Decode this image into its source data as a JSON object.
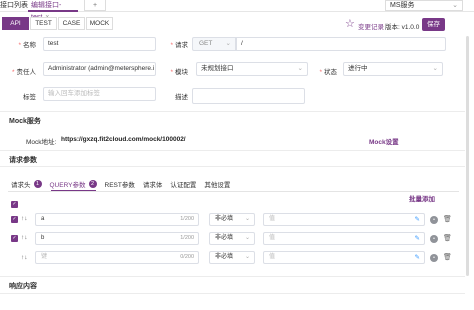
{
  "top_tabs": {
    "list": "接口列表",
    "edit": "编辑接口-test",
    "close": "×",
    "add": "+"
  },
  "workspace": {
    "value": "MS服务",
    "chevron": "⌄"
  },
  "protocol_tabs": [
    "API",
    "TEST",
    "CASE",
    "MOCK"
  ],
  "header": {
    "changelog": "变更记录",
    "version": "版本: v1.0.0",
    "save": "保存"
  },
  "form": {
    "name_label": "名称",
    "name_value": "test",
    "request_label": "请求",
    "method": "GET",
    "path": "/",
    "owner_label": "责任人",
    "owner_value": "Administrator (admin@metersphere.i",
    "module_label": "模块",
    "module_value": "未规划接口",
    "status_label": "状态",
    "status_value": "进行中",
    "tag_label": "标签",
    "tag_placeholder": "输入回车添加标签",
    "desc_label": "描述"
  },
  "mock": {
    "title": "Mock服务",
    "addr_label": "Mock地址:",
    "addr": "https://gxzq.fit2cloud.com/mock/100002/",
    "setting": "Mock设置"
  },
  "request_params": {
    "title": "请求参数",
    "tabs": [
      {
        "label": "请求头",
        "badge": "1"
      },
      {
        "label": "QUERY参数",
        "badge": "2"
      },
      {
        "label": "REST参数",
        "badge": ""
      },
      {
        "label": "请求体",
        "badge": ""
      },
      {
        "label": "认证配置",
        "badge": ""
      },
      {
        "label": "其他设置",
        "badge": ""
      }
    ],
    "batch_add": "批量添加",
    "rows": [
      {
        "name": "a",
        "count": "1/200",
        "required": "非必填",
        "value_placeholder": "值"
      },
      {
        "name": "b",
        "count": "1/200",
        "required": "非必填",
        "value_placeholder": "值"
      },
      {
        "name": "键",
        "count": "0/200",
        "required": "非必填",
        "value_placeholder": "值"
      }
    ]
  },
  "response": {
    "title": "响应内容"
  },
  "icons": {
    "star": "☆",
    "check": "✓",
    "sort": "↑↓",
    "edit": "✎",
    "more": "•",
    "trash": "🗑"
  },
  "colors": {
    "accent": "#783887",
    "link": "#409eff"
  }
}
